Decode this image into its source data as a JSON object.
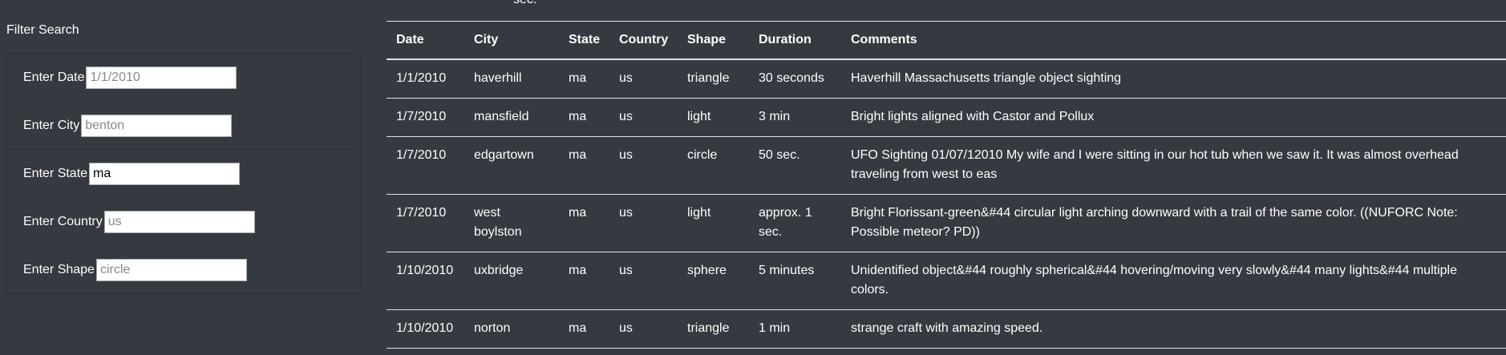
{
  "top_fragment": "sec.",
  "filter": {
    "title": "Filter Search",
    "fields": [
      {
        "label": "Enter Date",
        "value": "",
        "placeholder": "1/1/2010"
      },
      {
        "label": "Enter City",
        "value": "",
        "placeholder": "benton"
      },
      {
        "label": "Enter State",
        "value": "ma",
        "placeholder": ""
      },
      {
        "label": "Enter Country",
        "value": "",
        "placeholder": "us"
      },
      {
        "label": "Enter Shape",
        "value": "",
        "placeholder": "circle"
      }
    ]
  },
  "table": {
    "columns": [
      "Date",
      "City",
      "State",
      "Country",
      "Shape",
      "Duration",
      "Comments"
    ],
    "rows": [
      [
        "1/1/2010",
        "haverhill",
        "ma",
        "us",
        "triangle",
        "30 seconds",
        "Haverhill Massachusetts triangle object sighting"
      ],
      [
        "1/7/2010",
        "mansfield",
        "ma",
        "us",
        "light",
        "3 min",
        "Bright lights aligned with Castor and Pollux"
      ],
      [
        "1/7/2010",
        "edgartown",
        "ma",
        "us",
        "circle",
        "50 sec.",
        "UFO Sighting 01/07/12010 My wife and I were sitting in our hot tub when we saw it. It was almost overhead traveling from west to eas"
      ],
      [
        "1/7/2010",
        "west boylston",
        "ma",
        "us",
        "light",
        "approx. 1 sec.",
        "Bright Florissant-green&#44 circular light arching downward with a trail of the same color. ((NUFORC Note: Possible meteor? PD))"
      ],
      [
        "1/10/2010",
        "uxbridge",
        "ma",
        "us",
        "sphere",
        "5 minutes",
        "Unidentified object&#44 roughly spherical&#44 hovering/moving very slowly&#44 many lights&#44 multiple colors."
      ],
      [
        "1/10/2010",
        "norton",
        "ma",
        "us",
        "triangle",
        "1 min",
        "strange craft with amazing speed."
      ]
    ]
  }
}
